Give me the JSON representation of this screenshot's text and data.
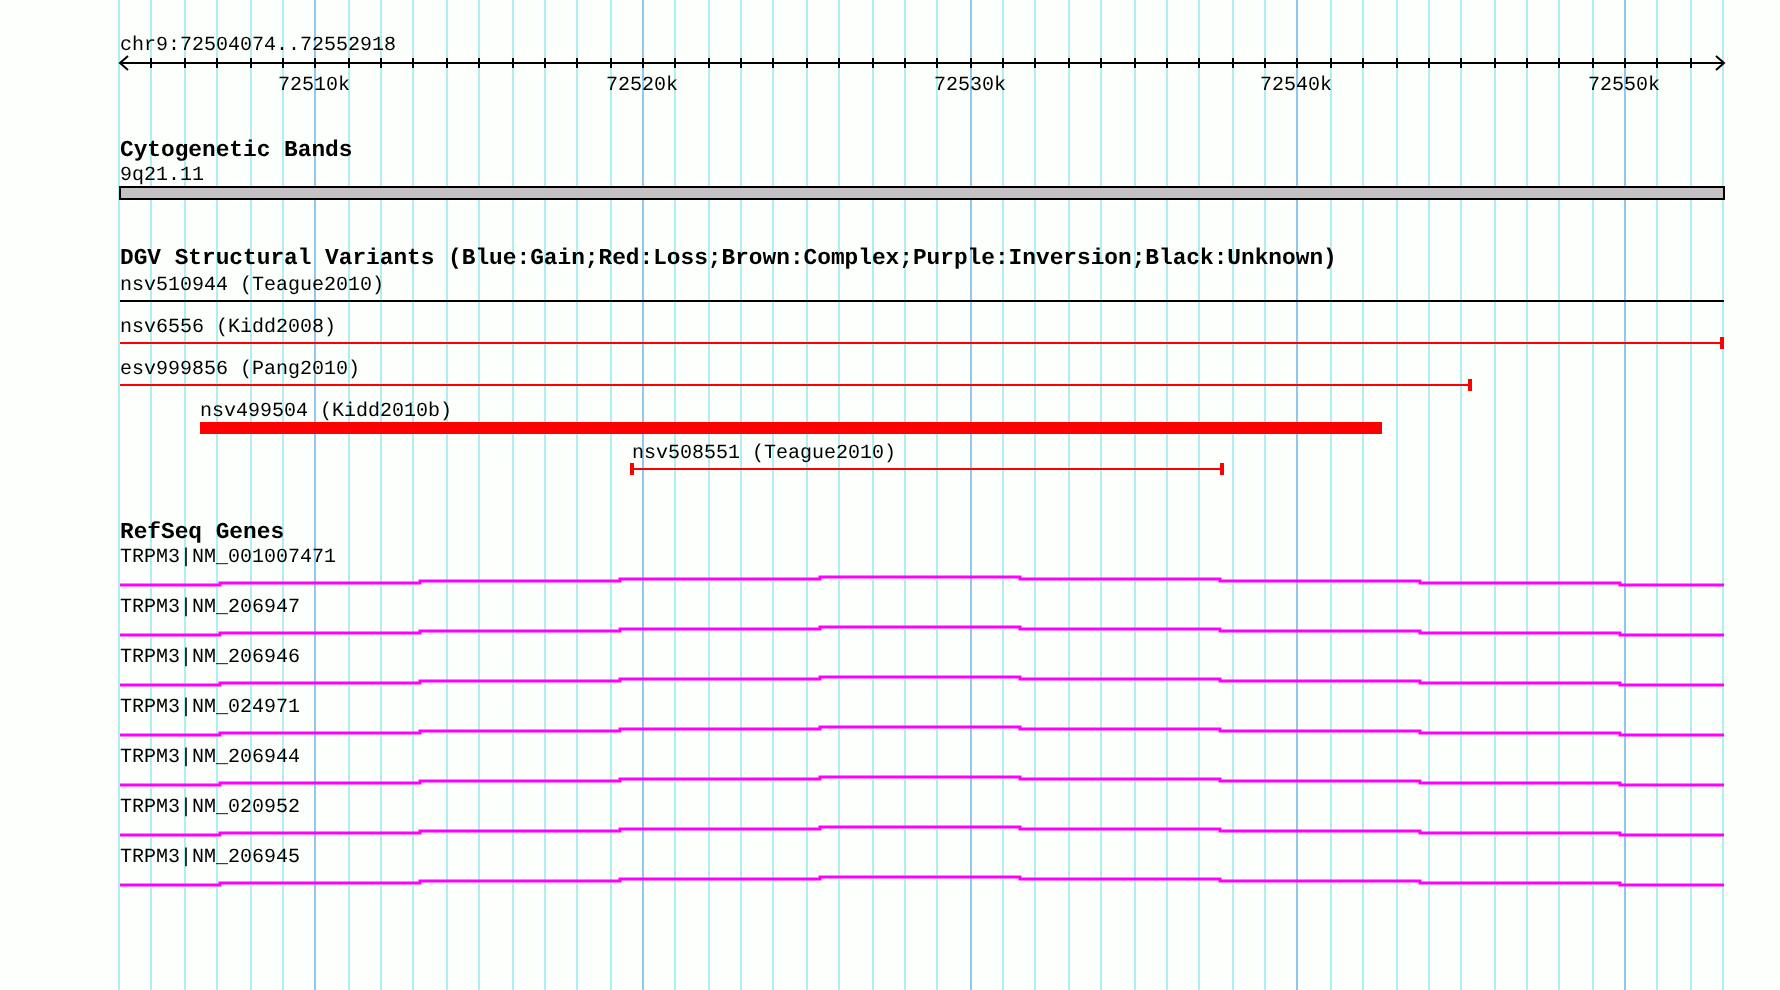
{
  "ruler": {
    "position": "chr9:72504074..72552918",
    "ticks": [
      "72510k",
      "72520k",
      "72530k",
      "72540k",
      "72550k"
    ]
  },
  "tracks": [
    {
      "kind": "bands",
      "title": "Cytogenetic Bands",
      "features": [
        {
          "label": "9q21.11"
        }
      ]
    },
    {
      "kind": "variants",
      "title": "DGV Structural Variants (Blue:Gain;Red:Loss;Brown:Complex;Purple:Inversion;Black:Unknown)",
      "features": [
        {
          "label": "nsv510944 (Teague2010)",
          "color": "#000000",
          "kind": "line"
        },
        {
          "label": "nsv6556 (Kidd2008)",
          "color": "#ff0000",
          "kind": "line"
        },
        {
          "label": "esv999856 (Pang2010)",
          "color": "#ff0000",
          "kind": "line"
        },
        {
          "label": "nsv499504 (Kidd2010b)",
          "color": "#ff0000",
          "kind": "bar"
        },
        {
          "label": "nsv508551 (Teague2010)",
          "color": "#ff0000",
          "kind": "line"
        }
      ]
    },
    {
      "kind": "genes",
      "title": "RefSeq Genes",
      "features": [
        {
          "label": "TRPM3|NM_001007471"
        },
        {
          "label": "TRPM3|NM_206947"
        },
        {
          "label": "TRPM3|NM_206946"
        },
        {
          "label": "TRPM3|NM_024971"
        },
        {
          "label": "TRPM3|NM_206944"
        },
        {
          "label": "TRPM3|NM_020952"
        },
        {
          "label": "TRPM3|NM_206945"
        }
      ]
    }
  ]
}
